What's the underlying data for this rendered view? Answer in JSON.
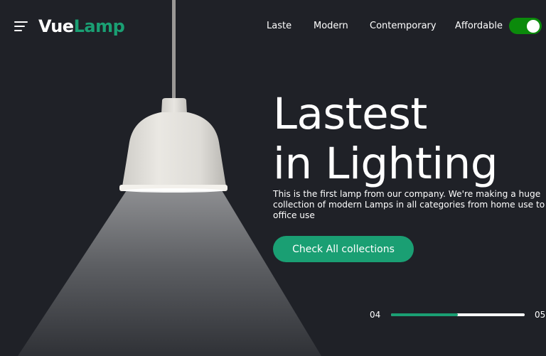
{
  "header": {
    "logo_primary": "Vue",
    "logo_accent": "Lamp",
    "nav": [
      {
        "label": "Laste"
      },
      {
        "label": "Modern"
      },
      {
        "label": "Contemporary"
      },
      {
        "label": "Affordable"
      }
    ],
    "theme_toggle_on": true
  },
  "hero": {
    "title_line1": "Lastest",
    "title_line2": "in Lighting",
    "description": "This is the first lamp from our company. We're making a huge collection of modern Lamps in all categories from home use to office use",
    "cta_label": "Check All collections"
  },
  "slider": {
    "current": "04",
    "total": "05",
    "progress": 0.5
  },
  "colors": {
    "background": "#1f2127",
    "accent": "#1a9f73",
    "toggle": "#0b8a0b",
    "text": "#ffffff"
  }
}
